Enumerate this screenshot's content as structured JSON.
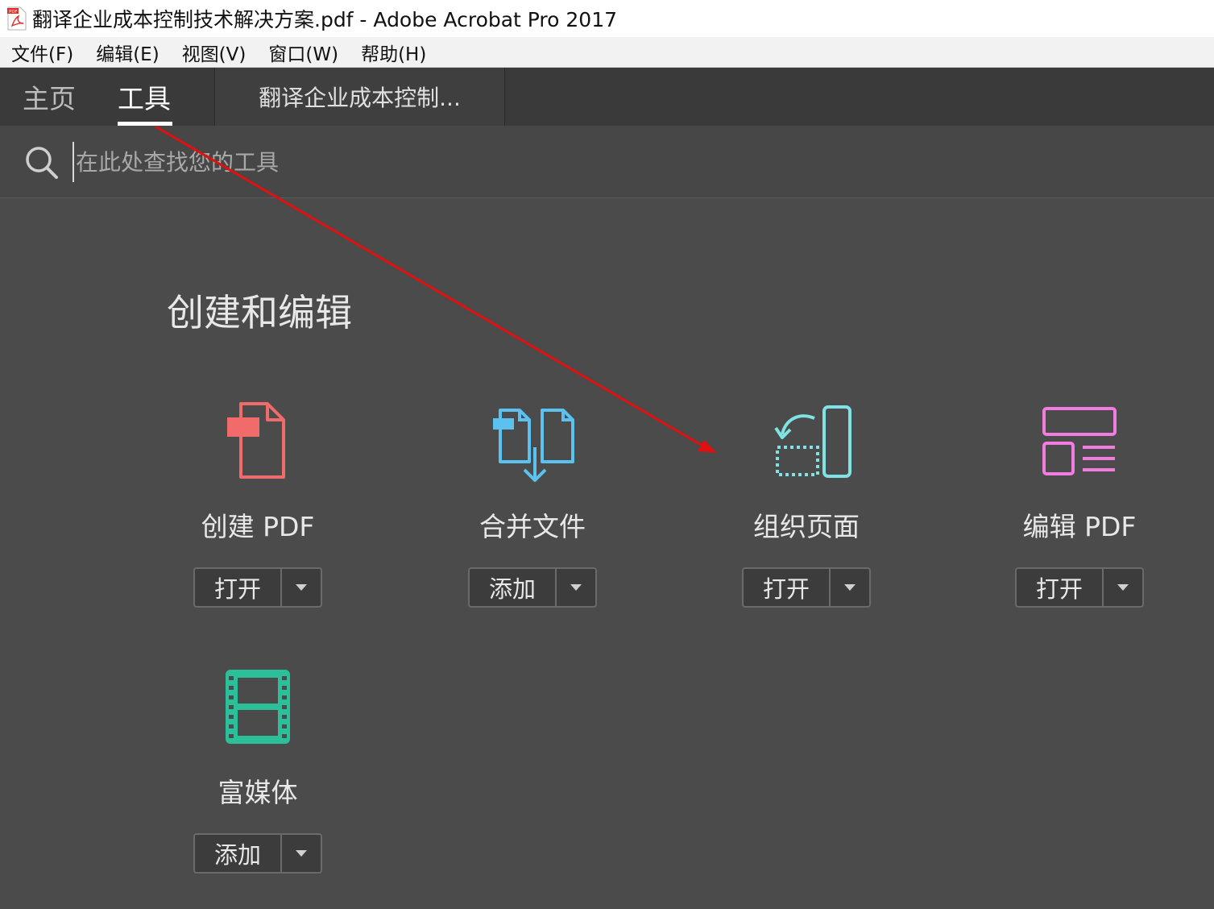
{
  "window": {
    "title": "翻译企业成本控制技术解决方案.pdf - Adobe Acrobat Pro 2017",
    "app_icon_label": "PDF"
  },
  "menu": {
    "items": [
      {
        "label": "文件(F)"
      },
      {
        "label": "编辑(E)"
      },
      {
        "label": "视图(V)"
      },
      {
        "label": "窗口(W)"
      },
      {
        "label": "帮助(H)"
      }
    ]
  },
  "tabs": {
    "home": "主页",
    "tools": "工具",
    "document": "翻译企业成本控制...",
    "active": "tools"
  },
  "search": {
    "placeholder": "在此处查找您的工具",
    "value": ""
  },
  "section": {
    "title": "创建和编辑"
  },
  "tools": [
    {
      "label": "创建 PDF",
      "button": "打开",
      "icon": "create-pdf-icon",
      "color": "#f26b6b"
    },
    {
      "label": "合并文件",
      "button": "添加",
      "icon": "combine-files-icon",
      "color": "#5bc2f0"
    },
    {
      "label": "组织页面",
      "button": "打开",
      "icon": "organize-pages-icon",
      "color": "#7fe3e3"
    },
    {
      "label": "编辑 PDF",
      "button": "打开",
      "icon": "edit-pdf-icon",
      "color": "#f27ce0"
    },
    {
      "label": "富媒体",
      "button": "添加",
      "icon": "rich-media-icon",
      "color": "#2bbf9a"
    }
  ],
  "colors": {
    "background": "#4b4b4b",
    "tabbar": "#3a3a3a",
    "annotation_arrow": "#e01010"
  }
}
